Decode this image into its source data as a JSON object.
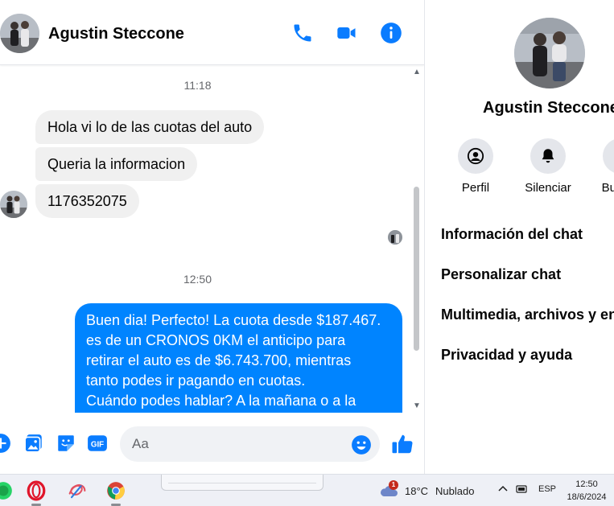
{
  "contact": {
    "name": "Agustin Steccone"
  },
  "chat": {
    "messages": [
      {
        "type": "timestamp",
        "text": "11:18"
      },
      {
        "type": "incoming",
        "text": "Hola vi lo de las cuotas del auto"
      },
      {
        "type": "incoming",
        "text": "Queria la informacion"
      },
      {
        "type": "incoming",
        "text": "1176352075"
      },
      {
        "type": "timestamp",
        "text": "12:50"
      },
      {
        "type": "outgoing",
        "lines": [
          "Buen dia! Perfecto! La cuota desde $187.467.",
          "es de un CRONOS 0KM el anticipo para",
          "retirar el auto es de $6.743.700, mientras",
          "tanto podes ir pagando en cuotas.",
          "Cuándo podes hablar? A la mañana o a la"
        ]
      }
    ]
  },
  "composer": {
    "placeholder": "Aa",
    "gif_label": "GIF"
  },
  "info_panel": {
    "actions": [
      {
        "label": "Perfil",
        "icon": "profile-icon"
      },
      {
        "label": "Silenciar",
        "icon": "bell-icon"
      },
      {
        "label": "Buscar",
        "icon": "search-icon"
      }
    ],
    "sections": [
      "Información del chat",
      "Personalizar chat",
      "Multimedia, archivos y enlaces",
      "Privacidad y ayuda"
    ]
  },
  "colors": {
    "accent": "#0084ff",
    "icon_blue": "#0a7cff",
    "incoming_bubble": "#f0f0f0",
    "action_circle": "#e4e6eb",
    "taskbar": "#eef0f6"
  },
  "taskbar": {
    "apps": [
      "green-app-icon",
      "opera-icon",
      "sketch-app-icon",
      "chrome-icon"
    ],
    "weather": {
      "temp": "18°C",
      "desc": "Nublado",
      "badge": "1"
    },
    "language": "ESP",
    "time": "12:50",
    "date": "18/6/2024"
  }
}
